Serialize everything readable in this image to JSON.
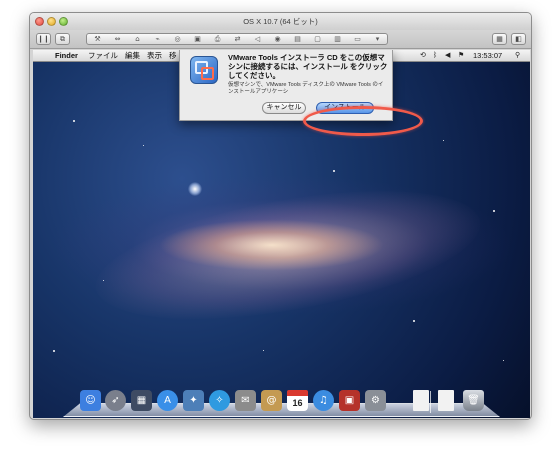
{
  "window": {
    "title": "OS X 10.7 (64 ビット)"
  },
  "vm_toolbar": {
    "buttons": [
      "pause-icon",
      "snapshot-icon",
      "settings-icon",
      "fullscreen-icon",
      "share-icon",
      "usb-icon",
      "cd-icon",
      "floppy-icon",
      "printer-icon",
      "network-icon",
      "sound-icon",
      "camera-icon",
      "shared-folder-icon",
      "right-panel-icon"
    ]
  },
  "menubar": {
    "apple": "",
    "app_name": "Finder",
    "items": [
      "ファイル",
      "編集",
      "表示",
      "移"
    ],
    "status_icons": [
      "time-machine-icon",
      "bluetooth-icon",
      "volume-icon",
      "flag-icon"
    ],
    "clock": "13:53:07",
    "spotlight": "search-icon"
  },
  "dialog": {
    "heading": "VMware Tools インストーラ CD をこの仮想マシンに接続するには、インストール をクリックしてください。",
    "body": "仮想マシンで、VMware Tools ディスク上の VMware Tools のインストールアプリケーシ",
    "cancel_label": "キャンセル",
    "install_label": "インストール"
  },
  "annotation": {
    "highlight_color": "#f05a4a"
  },
  "dock": {
    "apps": [
      {
        "name": "Finder",
        "icon": "finder-icon",
        "color": "#3d7fe0"
      },
      {
        "name": "Launchpad",
        "icon": "rocket-icon",
        "color": "#7a7f8c"
      },
      {
        "name": "Mission Control",
        "icon": "mission-control-icon",
        "color": "#3e4b63"
      },
      {
        "name": "App Store",
        "icon": "app-store-icon",
        "color": "#3a8fe8"
      },
      {
        "name": "Preview",
        "icon": "photo-icon",
        "color": "#4d7fb8"
      },
      {
        "name": "Safari",
        "icon": "safari-icon",
        "color": "#2f9ae0"
      },
      {
        "name": "Mail",
        "icon": "mail-icon",
        "color": "#8c8c8c"
      },
      {
        "name": "Address Book",
        "icon": "contacts-icon",
        "color": "#c49a52"
      },
      {
        "name": "iCal",
        "icon": "calendar-icon",
        "day": "16"
      },
      {
        "name": "iTunes",
        "icon": "music-icon",
        "color": "#3b8ce0"
      },
      {
        "name": "Photo Booth",
        "icon": "photo-booth-icon",
        "color": "#b5322a"
      },
      {
        "name": "System Preferences",
        "icon": "gear-icon",
        "color": "#8a8f97"
      }
    ],
    "documents": [
      "document-icon",
      "document-icon"
    ],
    "trash": "trash-icon"
  }
}
